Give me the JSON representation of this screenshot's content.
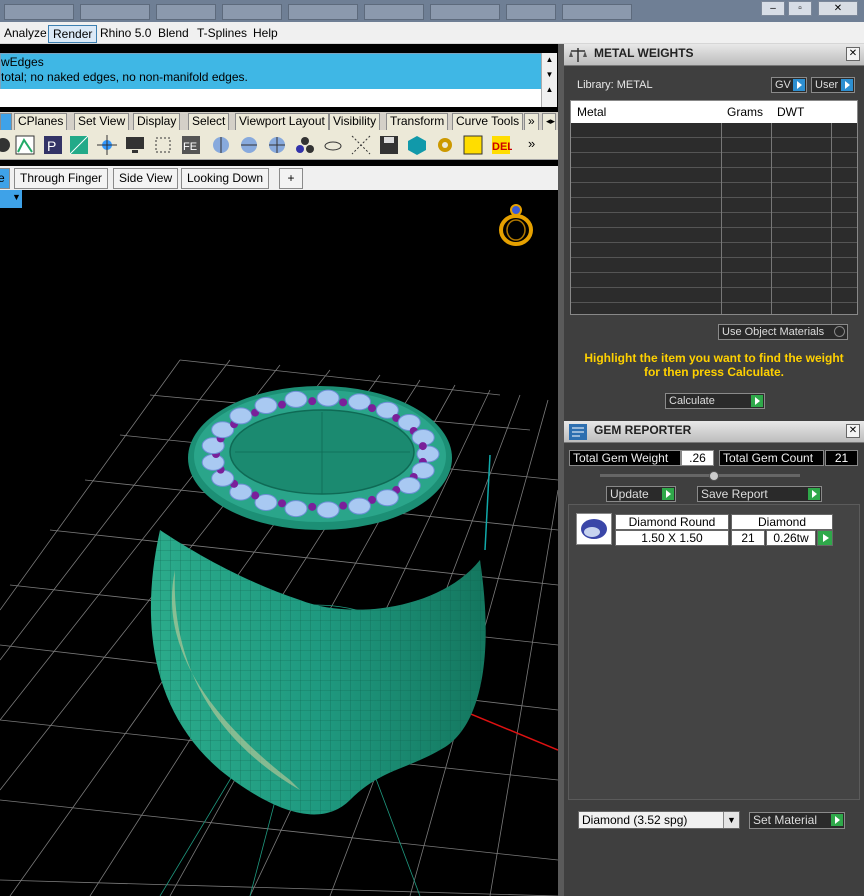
{
  "menu": {
    "items": [
      "Analyze",
      "Render",
      "Rhino 5.0",
      "Blend",
      "T-Splines",
      "Help"
    ]
  },
  "command": {
    "line1": "wEdges",
    "line2": " total; no naked edges, no non-manifold edges."
  },
  "toolbar_tabs": [
    "CPlanes",
    "Set View",
    "Display",
    "Select",
    "Viewport Layout",
    "Visibility",
    "Transform",
    "Curve Tools",
    "»"
  ],
  "viewport_tabs": [
    "e",
    "Through Finger",
    "Side View",
    "Looking Down",
    "+"
  ],
  "metal_weights": {
    "title": "METAL WEIGHTS",
    "library_label": "Library: METAL",
    "gv_label": "GV",
    "user_label": "User",
    "columns": [
      "Metal",
      "Grams",
      "DWT"
    ],
    "use_object_materials": "Use Object Materials",
    "hint": "Highlight the item you want to find the weight for then press Calculate.",
    "calculate_label": "Calculate"
  },
  "gem_reporter": {
    "title": "GEM REPORTER",
    "total_weight_label": "Total Gem Weight",
    "total_weight_value": ".26",
    "total_count_label": "Total Gem Count",
    "total_count_value": "21",
    "update_label": "Update",
    "save_report_label": "Save Report",
    "gems": [
      {
        "shape": "Diamond Round",
        "material": "Diamond",
        "size": "1.50 X 1.50",
        "count": "21",
        "weight": "0.26tw"
      }
    ],
    "material_select": "Diamond     (3.52 spg)",
    "set_material_label": "Set Material"
  },
  "colors": {
    "ring": "#1f9a80",
    "command_bg": "#3fb7e5",
    "hint": "#ffd100",
    "panel_bg": "#3f3f3f"
  }
}
